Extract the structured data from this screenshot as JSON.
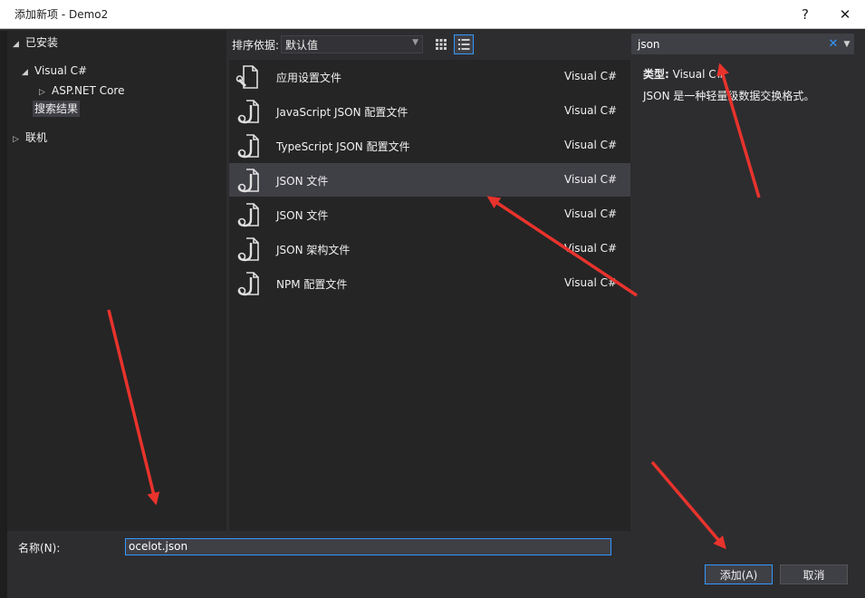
{
  "window": {
    "title": "添加新项 - Demo2",
    "help_label": "?",
    "close_label": "✕"
  },
  "tree": {
    "installed": "已安装",
    "visual_csharp": "Visual C#",
    "aspnet_core": "ASP.NET Core",
    "search_results": "搜索结果",
    "online": "联机"
  },
  "toolbar": {
    "sort_label": "排序依据:",
    "sort_value": "默认值"
  },
  "search": {
    "value": "json"
  },
  "templates": [
    {
      "name": "应用设置文件",
      "lang": "Visual C#",
      "icon": "settings-file-icon"
    },
    {
      "name": "JavaScript JSON 配置文件",
      "lang": "Visual C#",
      "icon": "json-file-icon"
    },
    {
      "name": "TypeScript JSON 配置文件",
      "lang": "Visual C#",
      "icon": "json-file-icon"
    },
    {
      "name": "JSON 文件",
      "lang": "Visual C#",
      "icon": "json-file-icon",
      "selected": true
    },
    {
      "name": "JSON 文件",
      "lang": "Visual C#",
      "icon": "json-file-icon"
    },
    {
      "name": "JSON 架构文件",
      "lang": "Visual C#",
      "icon": "json-file-icon"
    },
    {
      "name": "NPM 配置文件",
      "lang": "Visual C#",
      "icon": "json-file-icon"
    }
  ],
  "details": {
    "type_label": "类型:",
    "type_value": "Visual C#",
    "description": "JSON 是一种轻量级数据交换格式。"
  },
  "footer": {
    "name_label": "名称(N):",
    "name_value": "ocelot.json",
    "add_label": "添加(A)",
    "cancel_label": "取消"
  },
  "colors": {
    "accent": "#3399ff",
    "annotation_arrow": "#e8332c"
  }
}
